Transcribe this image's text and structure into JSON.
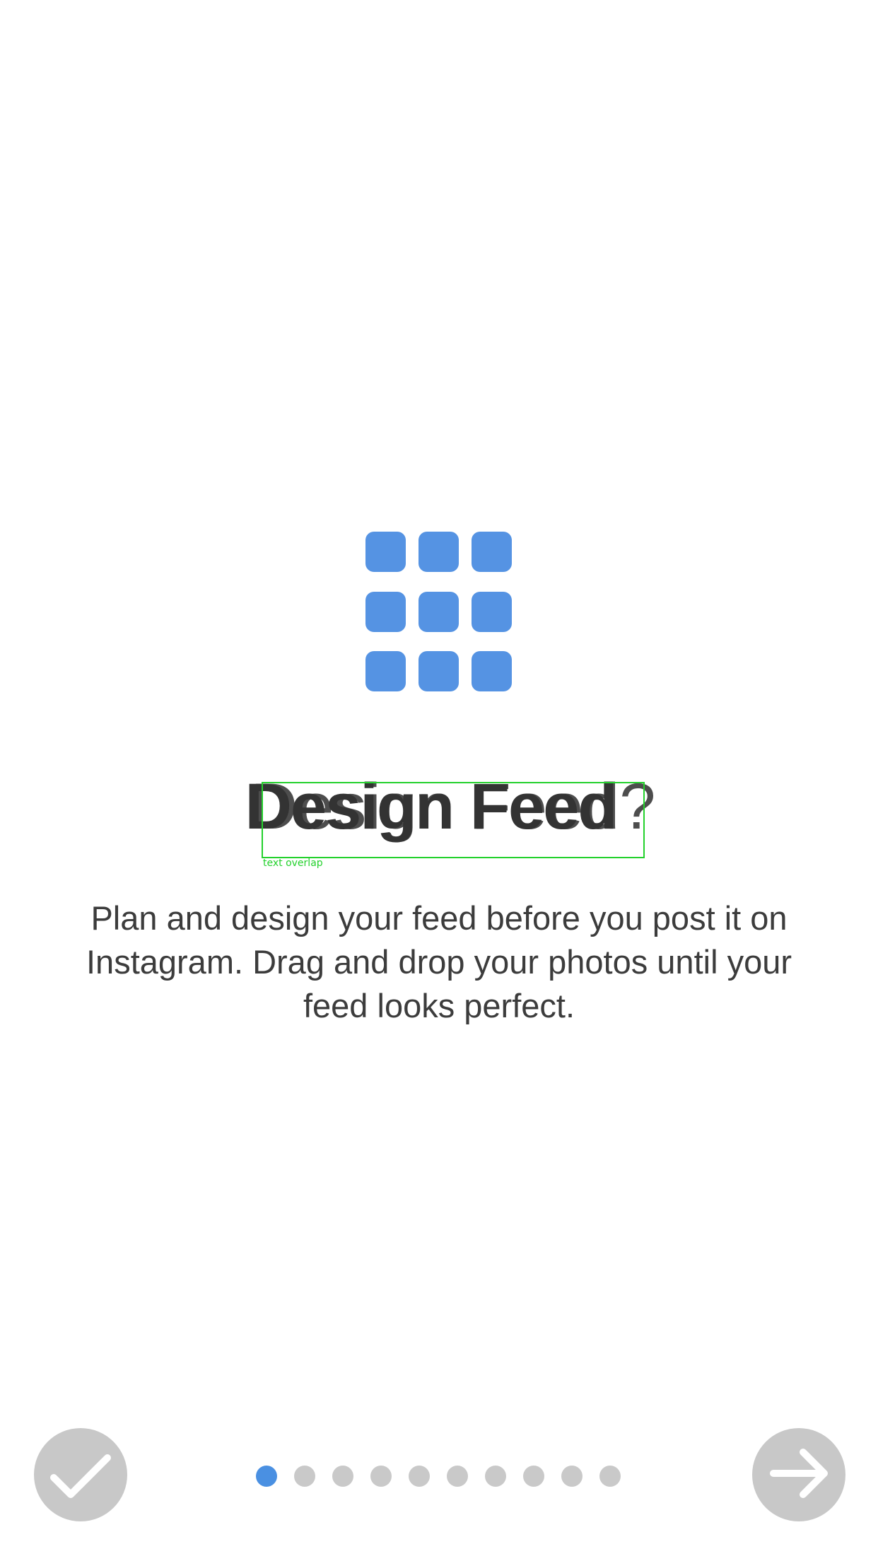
{
  "onboarding": {
    "title": "Design Feed",
    "title_overlap": "Design Feed?",
    "description": "Plan and design your feed before you post it on Instagram. Drag and drop your photos until your feed looks perfect.",
    "debug_label": "text overlap",
    "icon": "grid-icon"
  },
  "controls": {
    "done_icon": "checkmark-icon",
    "next_icon": "arrow-right-icon"
  },
  "pagination": {
    "total": 10,
    "current": 1
  },
  "colors": {
    "accent": "#4a90e2",
    "icon_blue": "#5593e3",
    "button_gray": "#c8c8c8",
    "dot_gray": "#c9c9c9",
    "text": "#333333",
    "debug_green": "#23d12c"
  }
}
